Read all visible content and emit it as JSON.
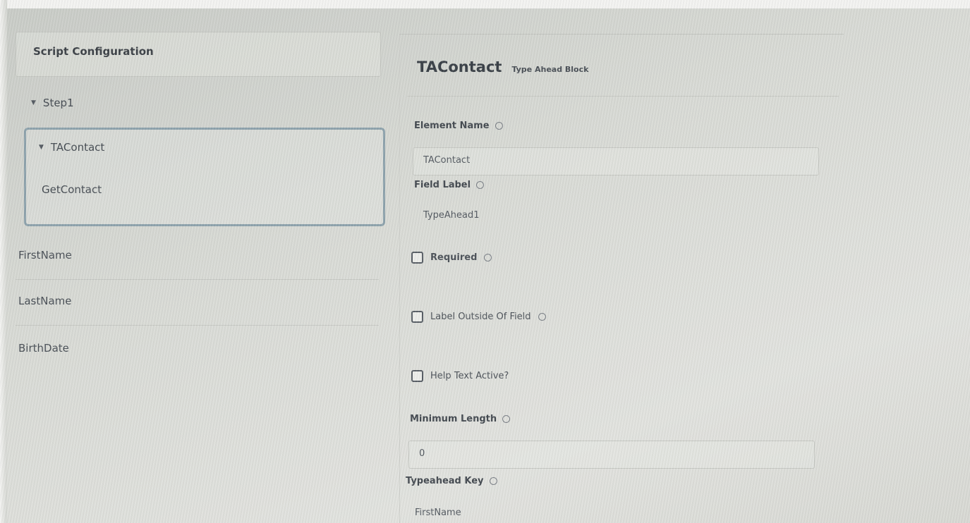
{
  "left_panel": {
    "header": "Script Configuration",
    "step": "Step1",
    "group": {
      "title": "TAContact",
      "child": "GetContact"
    },
    "fields": [
      "FirstName",
      "LastName",
      "BirthDate"
    ]
  },
  "right_panel": {
    "title": "TAContact",
    "subtitle": "Type Ahead Block",
    "element_name": {
      "label": "Element Name",
      "value": "TAContact"
    },
    "field_label": {
      "label": "Field Label",
      "value": "TypeAhead1"
    },
    "checkboxes": [
      {
        "label": "Required",
        "checked": false
      },
      {
        "label": "Label Outside Of Field",
        "checked": false
      },
      {
        "label": "Help Text Active?",
        "checked": false
      }
    ],
    "minimum_length": {
      "label": "Minimum Length",
      "value": "0"
    },
    "typeahead_key": {
      "label": "Typeahead Key",
      "value": "FirstName"
    }
  },
  "icons": {
    "info": "info-icon",
    "caret": "caret-down-icon",
    "checkbox": "checkbox-icon"
  }
}
